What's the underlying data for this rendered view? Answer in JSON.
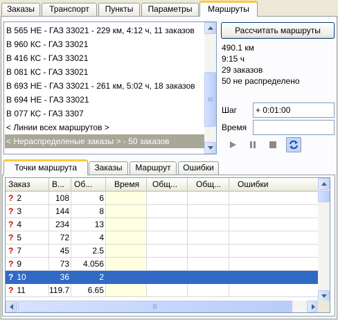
{
  "main_tabs": [
    {
      "label": "Заказы"
    },
    {
      "label": "Транспорт"
    },
    {
      "label": "Пункты"
    },
    {
      "label": "Параметры"
    },
    {
      "label": "Маршруты",
      "active": true
    }
  ],
  "routes": {
    "items": [
      "В 565 НЕ - ГАЗ 33021 - 229 км, 4:12 ч, 11 заказов",
      "В 960 КС - ГАЗ 33021",
      "В 416 КС - ГАЗ 33021",
      "В 081 КС - ГАЗ 33021",
      "В 693 НЕ - ГАЗ 33021 - 261 км, 5:02 ч, 18 заказов",
      "В 694 НЕ - ГАЗ 33021",
      "В 077 КС - ГАЗ 3307",
      "< Линии всех маршрутов >",
      "< Нераспределеные заказы > - 50 заказов"
    ],
    "selected_index": 8,
    "scroll_position": 0.8
  },
  "calc_button": "Рассчитать маршруты",
  "summary": {
    "distance": "490.1 км",
    "time": "9:15 ч",
    "orders": "29 заказов",
    "unassigned": "50 не распределено"
  },
  "step": {
    "label": "Шаг",
    "value": "+ 0:01:00"
  },
  "time_field": {
    "label": "Время",
    "value": ""
  },
  "playback": {
    "icons": [
      "play-icon",
      "pause-icon",
      "stop-icon",
      "refresh-icon"
    ],
    "active": "refresh-icon"
  },
  "sub_tabs": [
    {
      "label": "Точки маршрута",
      "active": true
    },
    {
      "label": "Заказы"
    },
    {
      "label": "Маршрут"
    },
    {
      "label": "Ошибки"
    }
  ],
  "grid": {
    "columns": [
      "Заказ",
      "В...",
      "Об...",
      "Время",
      "Общ...",
      "Общ...",
      "Ошибки"
    ],
    "rows": [
      {
        "mark": "?",
        "order": "2",
        "v": "108",
        "ob": "6"
      },
      {
        "mark": "?",
        "order": "3",
        "v": "144",
        "ob": "8"
      },
      {
        "mark": "?",
        "order": "4",
        "v": "234",
        "ob": "13"
      },
      {
        "mark": "?",
        "order": "5",
        "v": "72",
        "ob": "4"
      },
      {
        "mark": "?",
        "order": "7",
        "v": "45",
        "ob": "2.5"
      },
      {
        "mark": "?",
        "order": "9",
        "v": "73",
        "ob": "4.056"
      },
      {
        "mark": "?",
        "order": "10",
        "v": "36",
        "ob": "2",
        "selected": true
      },
      {
        "mark": "?",
        "order": "11",
        "v": "119.7",
        "ob": "6.65"
      }
    ]
  },
  "colors": {
    "accent_tab": "#ffc83c",
    "selection": "#316ac5",
    "time_column": "#ffffe1",
    "question_mark": "#cc0000"
  }
}
